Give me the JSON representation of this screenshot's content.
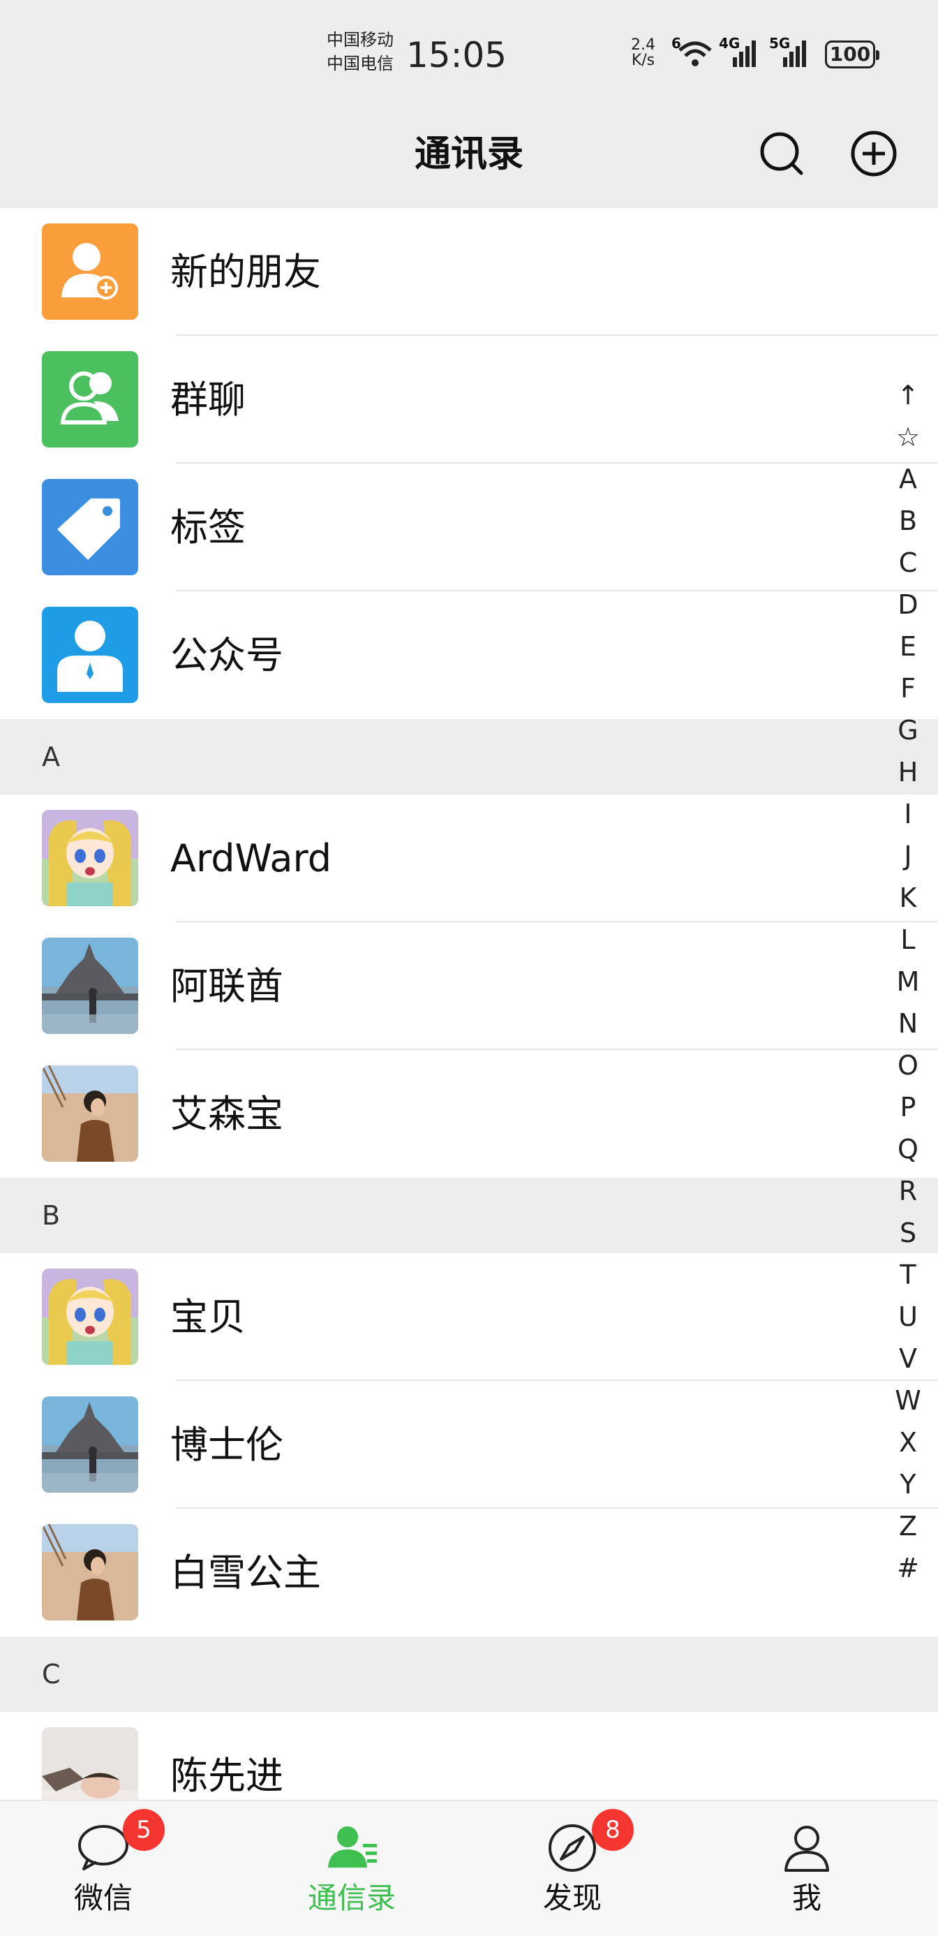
{
  "status_bar": {
    "carrier_1": "中国移动",
    "carrier_2": "中国电信",
    "time": "15:05",
    "speed_value": "2.4",
    "speed_unit": "K/s",
    "wifi_label": "6",
    "sim1_label": "4G",
    "sim2_label": "5G",
    "battery": "100"
  },
  "header": {
    "title": "通讯录",
    "search_icon": "search-icon",
    "add_icon": "plus-circle-icon"
  },
  "function_items": [
    {
      "label": "新的朋友",
      "icon": "add-friend-icon",
      "color": "#fa9d3b"
    },
    {
      "label": "群聊",
      "icon": "group-chat-icon",
      "color": "#4cbf5f"
    },
    {
      "label": "标签",
      "icon": "tag-icon",
      "color": "#3b8ee0"
    },
    {
      "label": "公众号",
      "icon": "official-account-icon",
      "color": "#1e9de6"
    }
  ],
  "sections": [
    {
      "letter": "A",
      "contacts": [
        {
          "name": "ArdWard",
          "avatar": "anime-girl-avatar"
        },
        {
          "name": "阿联酋",
          "avatar": "castle-photo-avatar"
        },
        {
          "name": "艾森宝",
          "avatar": "man-wall-photo-avatar"
        }
      ]
    },
    {
      "letter": "B",
      "contacts": [
        {
          "name": "宝贝",
          "avatar": "anime-girl-avatar"
        },
        {
          "name": "博士伦",
          "avatar": "castle-photo-avatar"
        },
        {
          "name": "白雪公主",
          "avatar": "man-wall-photo-avatar"
        }
      ]
    },
    {
      "letter": "C",
      "contacts": [
        {
          "name": "陈先进",
          "avatar": "sleeping-person-avatar"
        }
      ]
    }
  ],
  "alphabet_index": [
    "↑",
    "☆",
    "A",
    "B",
    "C",
    "D",
    "E",
    "F",
    "G",
    "H",
    "I",
    "J",
    "K",
    "L",
    "M",
    "N",
    "O",
    "P",
    "Q",
    "R",
    "S",
    "T",
    "U",
    "V",
    "W",
    "X",
    "Y",
    "Z",
    "#"
  ],
  "tabbar": {
    "tabs": [
      {
        "label": "微信",
        "icon": "chat-bubble-icon",
        "badge": "5"
      },
      {
        "label": "通信录",
        "icon": "contacts-icon",
        "badge": ""
      },
      {
        "label": "发现",
        "icon": "compass-icon",
        "badge": "8"
      },
      {
        "label": "我",
        "icon": "person-icon",
        "badge": ""
      }
    ],
    "active_color": "#3fbf4f",
    "badge_color": "#f43530"
  }
}
